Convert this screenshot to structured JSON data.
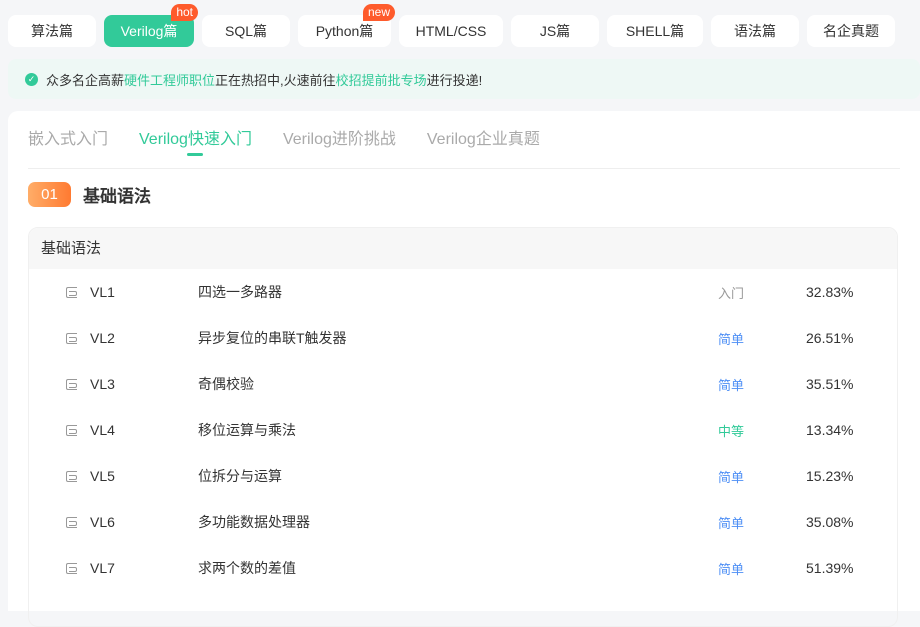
{
  "topnav": [
    {
      "label": "算法篇",
      "w": 88
    },
    {
      "label": "Verilog篇",
      "w": 90,
      "active": true,
      "badge": "hot"
    },
    {
      "label": "SQL篇",
      "w": 88
    },
    {
      "label": "Python篇",
      "w": 93,
      "badge": "new"
    },
    {
      "label": "HTML/CSS",
      "w": 104
    },
    {
      "label": "JS篇",
      "w": 88
    },
    {
      "label": "SHELL篇",
      "w": 96
    },
    {
      "label": "语法篇",
      "w": 88
    },
    {
      "label": "名企真题",
      "w": 88
    }
  ],
  "notice": {
    "t1": "众多名企高薪",
    "l1": "硬件工程师职位",
    "t2": "正在热招中,火速前往",
    "l2": "校招提前批专场",
    "t3": "进行投递!"
  },
  "tabs": [
    "嵌入式入门",
    "Verilog快速入门",
    "Verilog进阶挑战",
    "Verilog企业真题"
  ],
  "section": {
    "num": "01",
    "title": "基础语法",
    "group": "基础语法"
  },
  "problems": [
    {
      "code": "VL1",
      "title": "四选一多路器",
      "level": "入门",
      "rate": "32.83%"
    },
    {
      "code": "VL2",
      "title": "异步复位的串联T触发器",
      "level": "简单",
      "rate": "26.51%"
    },
    {
      "code": "VL3",
      "title": "奇偶校验",
      "level": "简单",
      "rate": "35.51%"
    },
    {
      "code": "VL4",
      "title": "移位运算与乘法",
      "level": "中等",
      "rate": "13.34%"
    },
    {
      "code": "VL5",
      "title": "位拆分与运算",
      "level": "简单",
      "rate": "15.23%"
    },
    {
      "code": "VL6",
      "title": "多功能数据处理器",
      "level": "简单",
      "rate": "35.08%"
    },
    {
      "code": "VL7",
      "title": "求两个数的差值",
      "level": "简单",
      "rate": "51.39%"
    }
  ],
  "level_colors": {
    "入门": "#999999",
    "简单": "#4e8ff5",
    "中等": "#32ca99"
  }
}
